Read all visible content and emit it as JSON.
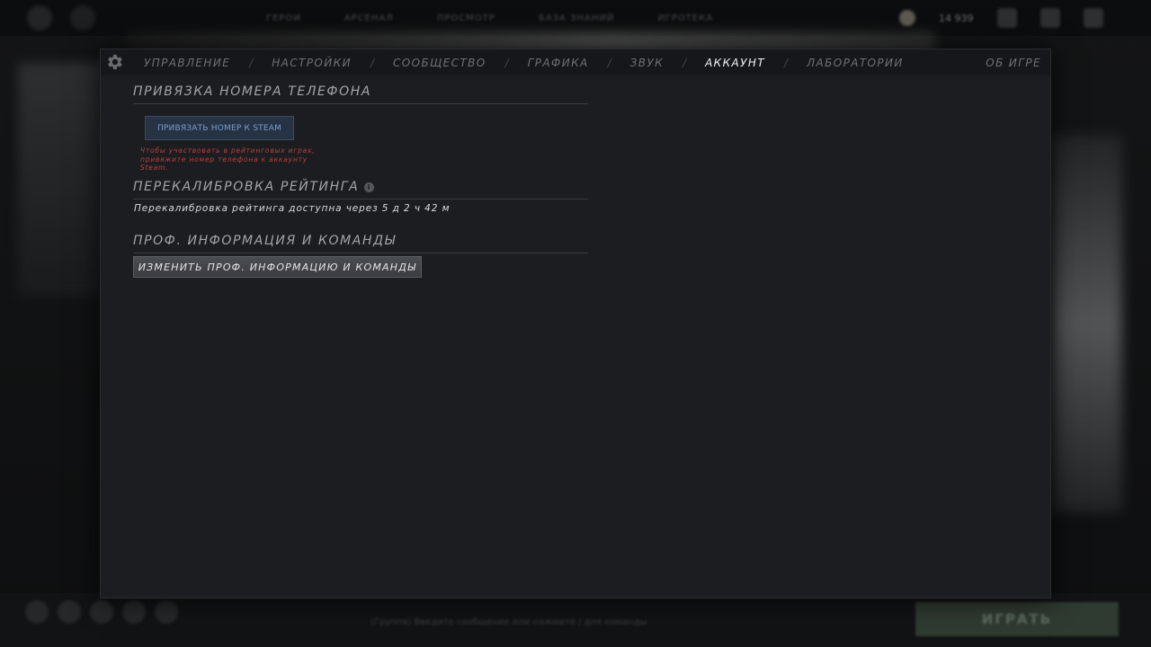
{
  "tabs": {
    "items": [
      {
        "label": "УПРАВЛЕНИЕ"
      },
      {
        "label": "НАСТРОЙКИ"
      },
      {
        "label": "СООБЩЕСТВО"
      },
      {
        "label": "ГРАФИКА"
      },
      {
        "label": "ЗВУК"
      },
      {
        "label": "АККАУНТ"
      },
      {
        "label": "ЛАБОРАТОРИИ"
      }
    ],
    "separator": "/",
    "active": "АККАУНТ",
    "about_label": "ОБ ИГРЕ"
  },
  "phone": {
    "title": "ПРИВЯЗКА НОМЕРА ТЕЛЕФОНА",
    "button_label": "ПРИВЯЗАТЬ НОМЕР К STEAM",
    "warning": "Чтобы участвовать в рейтинговых играх, привяжите номер телефона к аккаунту Steam."
  },
  "recalibration": {
    "title": "ПЕРЕКАЛИБРОВКА РЕЙТИНГА",
    "info_icon": "info-icon",
    "status": "Перекалибровка рейтинга доступна через 5 д 2 ч 42 м"
  },
  "pro": {
    "title": "ПРОФ. ИНФОРМАЦИЯ И КОМАНДЫ",
    "button_label": "ИЗМЕНИТЬ ПРОФ. ИНФОРМАЦИЮ И КОМАНДЫ"
  },
  "background": {
    "nav": [
      "ГЕРОИ",
      "АРСЕНАЛ",
      "ПРОСМОТР",
      "БАЗА ЗНАНИЙ",
      "ИГРОТЕКА"
    ],
    "currency": "14 939",
    "play_label": "ИГРАТЬ",
    "chat_hint": "(Группа) Введите сообщение или нажмите / для команды"
  },
  "colors": {
    "accent_blue": "#7d9cc5",
    "warning_red": "#b9403d",
    "active_tab": "#f2f3f4"
  }
}
